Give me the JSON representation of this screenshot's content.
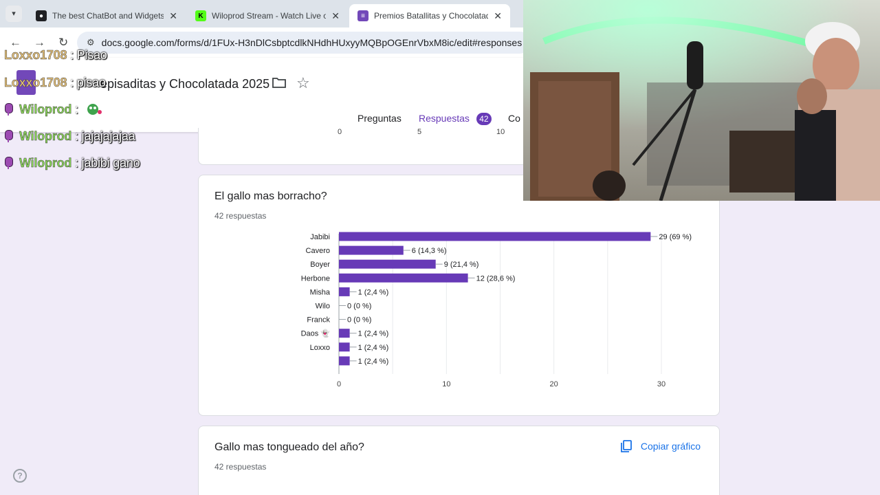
{
  "browser": {
    "tabs": [
      {
        "title": "The best ChatBot and Widgets",
        "fav_color": "#202124"
      },
      {
        "title": "Wiloprod Stream - Watch Live o",
        "fav_color": "#53fc18"
      },
      {
        "title": "Premios Batallitas y Chocolatad",
        "fav_color": "#7248b9"
      }
    ],
    "url": "docs.google.com/forms/d/1FUx-H3nDlCsbptcdlkNHdhHUxyyMQBpOGEnrVbxM8ic/edit#responses"
  },
  "form": {
    "title": "Premios Batallitas y Chocolatada 2025",
    "title_visible": "episaditas y Chocolatada 2025",
    "tabs": {
      "questions": "Preguntas",
      "responses": "Respuestas",
      "responses_count": "42",
      "settings": "Co"
    }
  },
  "prev_chart": {
    "ticks": [
      "0",
      "5",
      "10"
    ]
  },
  "question1": {
    "title": "El gallo mas borracho?",
    "count": "42 respuestas"
  },
  "question2": {
    "title": "Gallo mas tongueado del año?",
    "count": "42 respuestas",
    "copy_label": "Copiar gráfico"
  },
  "chart_data": {
    "type": "bar",
    "orientation": "horizontal",
    "categories": [
      "Jabibi",
      "Cavero",
      "Boyer",
      "Herbone",
      "Misha",
      "Wilo",
      "Franck",
      "Daos 👻",
      "Loxxo",
      ""
    ],
    "values": [
      29,
      6,
      9,
      12,
      1,
      0,
      0,
      1,
      1,
      1
    ],
    "labels": [
      "29 (69 %)",
      "6 (14,3 %)",
      "9 (21,4 %)",
      "12 (28,6 %)",
      "1 (2,4 %)",
      "0 (0 %)",
      "0 (0 %)",
      "1 (2,4 %)",
      "1 (2,4 %)",
      "1 (2,4 %)"
    ],
    "xlim": [
      0,
      30
    ],
    "xticks": [
      "0",
      "10",
      "20",
      "30"
    ],
    "grid": true,
    "color": "#673ab7"
  },
  "chat": [
    {
      "user": "Loxxo1708",
      "message": "Pisao",
      "color": "gold",
      "mic": false
    },
    {
      "user": "Loxxo1708",
      "message": "pisao",
      "color": "gold",
      "mic": false
    },
    {
      "user": "Wiloprod",
      "message": "",
      "color": "green",
      "mic": true
    },
    {
      "user": "Wiloprod",
      "message": "jajajajajaa",
      "color": "green",
      "mic": true
    },
    {
      "user": "Wiloprod",
      "message": "jabibi gano",
      "color": "green",
      "mic": true
    }
  ],
  "chat_sep": ":",
  "help_glyph": "?"
}
